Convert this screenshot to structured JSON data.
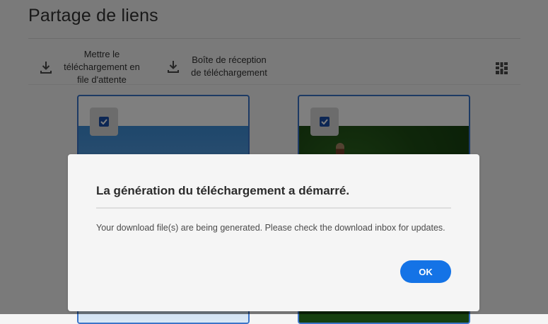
{
  "page": {
    "title": "Partage de liens"
  },
  "toolbar": {
    "queue_download_label": "Mettre le téléchargement en file d'attente",
    "download_inbox_label": "Boîte de réception de téléchargement",
    "view_icon": "grid-view-icon",
    "download_icon": "download-icon"
  },
  "cards": [
    {
      "checked": true,
      "thumbnail": "blue sky"
    },
    {
      "checked": true,
      "thumbnail": "green trees with person"
    }
  ],
  "dialog": {
    "title": "La génération du téléchargement a démarré.",
    "message": "Your download file(s) are being generated. Please check the download inbox for updates.",
    "ok_label": "OK"
  },
  "colors": {
    "accent": "#1473e6",
    "card_border": "#3b74c8",
    "checkbox": "#1a4ea8"
  }
}
